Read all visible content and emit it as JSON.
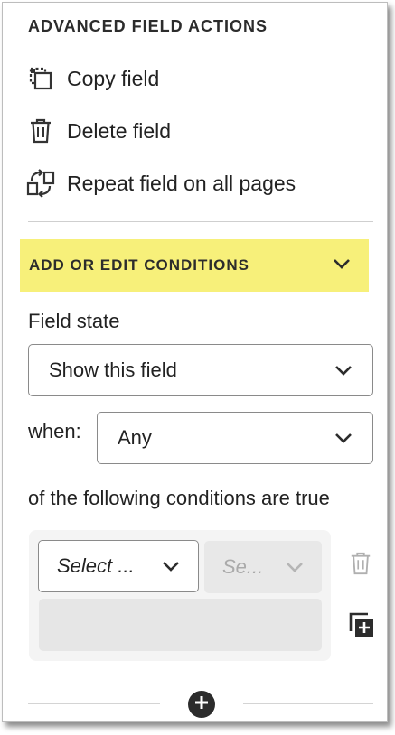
{
  "advanced": {
    "title": "ADVANCED FIELD ACTIONS",
    "actions": [
      {
        "label": "Copy field",
        "icon": "copy-icon"
      },
      {
        "label": "Delete field",
        "icon": "trash-icon"
      },
      {
        "label": "Repeat field on all pages",
        "icon": "repeat-icon"
      }
    ]
  },
  "conditions": {
    "header": "ADD OR EDIT CONDITIONS",
    "header_highlight": "#f7f07a",
    "field_state_label": "Field state",
    "field_state_value": "Show this field",
    "when_label": "when:",
    "when_value": "Any",
    "following_text": "of the following conditions are true",
    "rule": {
      "select_field": "Select ...",
      "select_operator": "Se..."
    }
  }
}
